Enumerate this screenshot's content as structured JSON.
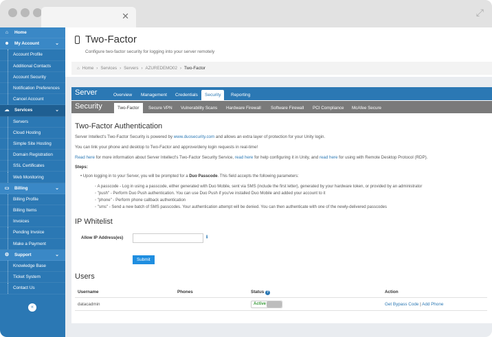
{
  "sidebar": {
    "items": [
      {
        "label": "Home",
        "type": "top",
        "icon": "home-icon"
      },
      {
        "label": "My Account",
        "type": "top",
        "icon": "user-icon",
        "expanded": true
      },
      {
        "label": "Account Profile",
        "type": "sub"
      },
      {
        "label": "Additional Contacts",
        "type": "sub"
      },
      {
        "label": "Account Security",
        "type": "sub"
      },
      {
        "label": "Notification Preferences",
        "type": "sub"
      },
      {
        "label": "Cancel Account",
        "type": "sub"
      },
      {
        "label": "Services",
        "type": "top",
        "icon": "cloud-icon",
        "expanded": true,
        "active": true
      },
      {
        "label": "Servers",
        "type": "sub"
      },
      {
        "label": "Cloud Hosting",
        "type": "sub"
      },
      {
        "label": "Simple Site Hosting",
        "type": "sub"
      },
      {
        "label": "Domain Registration",
        "type": "sub"
      },
      {
        "label": "SSL Certificates",
        "type": "sub"
      },
      {
        "label": "Web Monitoring",
        "type": "sub"
      },
      {
        "label": "Billing",
        "type": "top",
        "icon": "credit-card-icon",
        "expanded": true
      },
      {
        "label": "Billing Profile",
        "type": "sub"
      },
      {
        "label": "Billing Items",
        "type": "sub"
      },
      {
        "label": "Invoices",
        "type": "sub"
      },
      {
        "label": "Pending Invoice",
        "type": "sub"
      },
      {
        "label": "Make a Payment",
        "type": "sub"
      },
      {
        "label": "Support",
        "type": "top",
        "icon": "gear-icon",
        "expanded": true
      },
      {
        "label": "Knowledge Base",
        "type": "sub"
      },
      {
        "label": "Ticket System",
        "type": "sub"
      },
      {
        "label": "Contact Us",
        "type": "sub"
      }
    ],
    "collapse_symbol": "«"
  },
  "header": {
    "title": "Two-Factor",
    "subtitle": "Configure two-factor security for logging into your server remotely"
  },
  "breadcrumb": {
    "home": "Home",
    "items": [
      "Services",
      "Servers",
      "AZUREDEMO02",
      "Two-Factor"
    ],
    "separator": "›"
  },
  "server_bar": {
    "label": "Server",
    "tabs": [
      "Overview",
      "Management",
      "Credentials",
      "Security",
      "Reporting"
    ],
    "active": "Security"
  },
  "security_bar": {
    "label": "Security",
    "tabs": [
      "Two-Factor",
      "Secure VPN",
      "Vulnerability Scans",
      "Hardware Firewall",
      "Software Firewall",
      "PCI Compliance",
      "McAfee Secure"
    ],
    "active": "Two-Factor"
  },
  "twofactor": {
    "heading": "Two-Factor Authentication",
    "p1_pre": "Server Intellect's Two-Factor Security is powered by ",
    "p1_link": "www.duosecurity.com",
    "p1_post": " and allows an extra layer of protection for your Unity login.",
    "p2": "You can link your phone and desktop to Two-Factor and approve/deny login requests in real-time!",
    "p3_link1": "Read here",
    "p3_a": " for more information about Server Intellect's Two-Factor Security Service, ",
    "p3_link2": "read here",
    "p3_b": " for help configuring it in Unity, and ",
    "p3_link3": "read here",
    "p3_c": " for using with Remote Desktop Protocol (RDP).",
    "steps_label": "Steps:",
    "step1_pre": "Upon logging in to your Server, you will be prompted for a ",
    "step1_bold": "Duo Passcode",
    "step1_post": ". This field accepts the following parameters:",
    "params": [
      "A passcode - Log in using a passcode, either generated with Duo Mobile, sent via SMS (include the first letter), generated by your hardware token, or provided by an administrator",
      "\"push\" - Perform Duo Push authentication. You can use Duo Push if you've installed Duo Mobile and added your account to it",
      "\"phone\" - Perform phone callback authentication",
      "\"sms\" - Send a new batch of SMS passcodes. Your authentication attempt will be denied. You can then authenticate with one of the newly-delivered passcodes"
    ]
  },
  "whitelist": {
    "heading": "IP Whitelist",
    "label": "Allow IP Address(es)",
    "value": "",
    "placeholder": "",
    "info_icon": "info-icon",
    "submit": "Submit"
  },
  "users": {
    "heading": "Users",
    "columns": [
      "Username",
      "Phones",
      "Status",
      "Action"
    ],
    "rows": [
      {
        "username": "datacadmin",
        "phones": "",
        "status": "Active",
        "action1": "Get Bypass Code",
        "sep": " | ",
        "action2": "Add Phone"
      }
    ],
    "status_help_icon": "question-icon"
  },
  "colors": {
    "accent": "#2b78b4",
    "sidebar": "#2b78b4",
    "submit": "#1f8ee0",
    "active_status": "#3a9a3a"
  }
}
